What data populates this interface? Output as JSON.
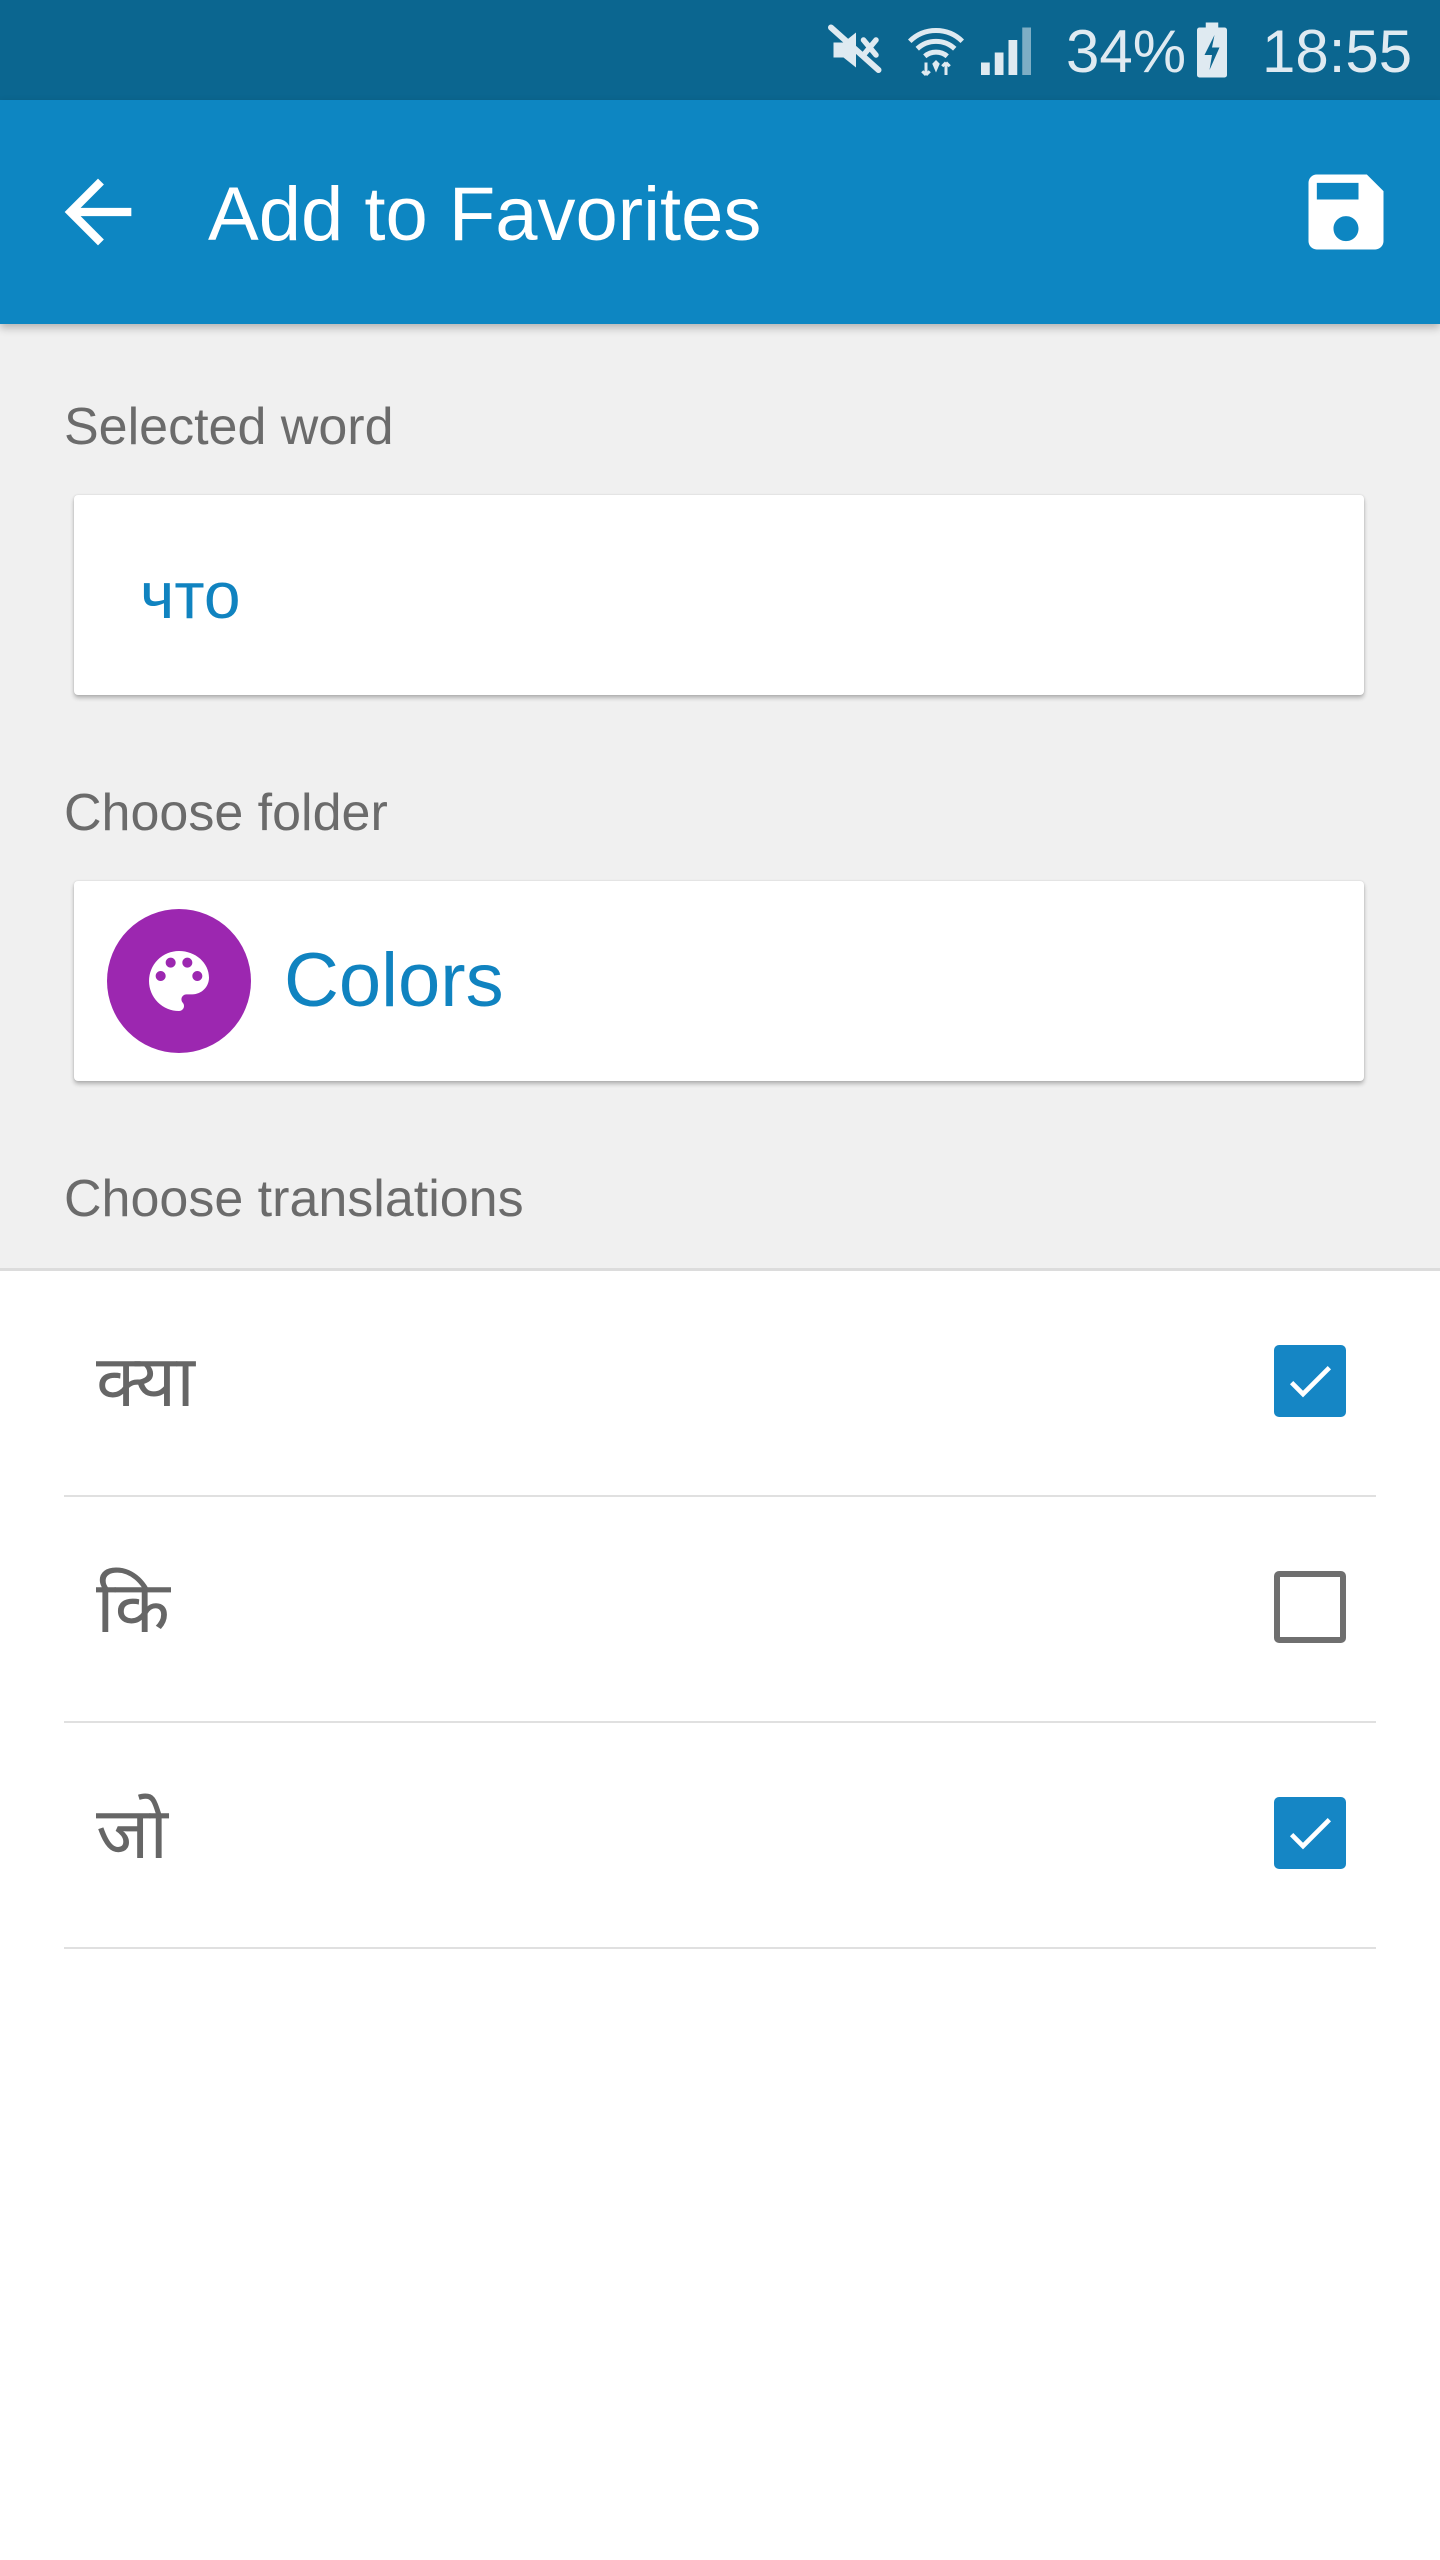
{
  "status_bar": {
    "battery": "34%",
    "time": "18:55",
    "icons": [
      "mute-icon",
      "wifi-icon",
      "signal-icon",
      "battery-charging-icon"
    ]
  },
  "app_bar": {
    "title": "Add to Favorites",
    "back_icon": "arrow-left-icon",
    "save_icon": "floppy-disk-save-icon"
  },
  "selected_word": {
    "label": "Selected word",
    "value": "что"
  },
  "folder": {
    "label": "Choose folder",
    "name": "Colors",
    "icon": "palette-icon",
    "icon_color": "#9c27b0"
  },
  "translations": {
    "label": "Choose translations",
    "items": [
      {
        "text": "क्या",
        "checked": true
      },
      {
        "text": "कि",
        "checked": false
      },
      {
        "text": "जो",
        "checked": true
      }
    ]
  },
  "colors": {
    "status_bar": "#0b6690",
    "app_bar": "#0d86c2",
    "accent": "#1586c5",
    "form_background": "#f0f0f0"
  }
}
